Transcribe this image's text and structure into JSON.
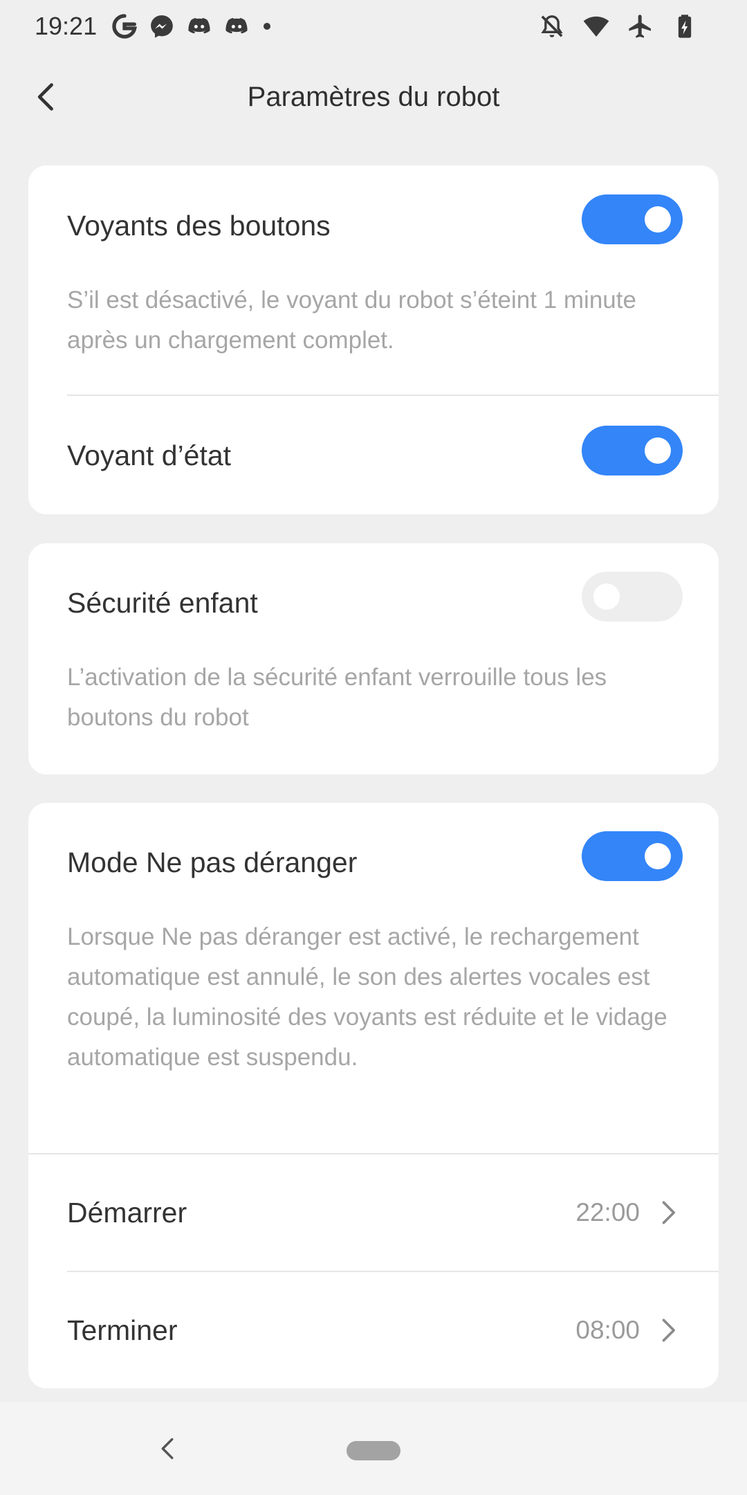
{
  "status_bar": {
    "time": "19:21",
    "left_icons": [
      "google-icon",
      "messenger-icon",
      "discord-icon",
      "discord-icon",
      "dot-icon"
    ],
    "right_icons": [
      "notifications-off-icon",
      "wifi-icon",
      "airplane-icon",
      "battery-charging-icon"
    ]
  },
  "header": {
    "title": "Paramètres du robot",
    "back_icon": "chevron-left-icon"
  },
  "settings": {
    "button_lights": {
      "label": "Voyants des boutons",
      "description": "S’il est désactivé, le voyant du robot s’éteint 1 minute après un chargement complet.",
      "enabled": true
    },
    "status_light": {
      "label": "Voyant d’état",
      "enabled": true
    },
    "child_lock": {
      "label": "Sécurité enfant",
      "description": "L’activation de la sécurité enfant verrouille tous les boutons du robot",
      "enabled": false
    },
    "dnd": {
      "label": "Mode Ne pas déranger",
      "description": "Lorsque Ne pas déranger est activé, le rechargement automatique est annulé, le son des alertes vocales est coupé, la luminosité des voyants est réduite et le vidage automatique est suspendu.",
      "enabled": true,
      "start_label": "Démarrer",
      "start_value": "22:00",
      "end_label": "Terminer",
      "end_value": "08:00"
    }
  },
  "colors": {
    "accent": "#3385f8",
    "background": "#efefef",
    "card": "#ffffff",
    "toggle_off": "#eeeeee",
    "secondary_text": "#a6a6a6"
  },
  "nav_bar": {
    "back_icon": "nav-back-icon",
    "home_icon": "home-pill-icon"
  }
}
